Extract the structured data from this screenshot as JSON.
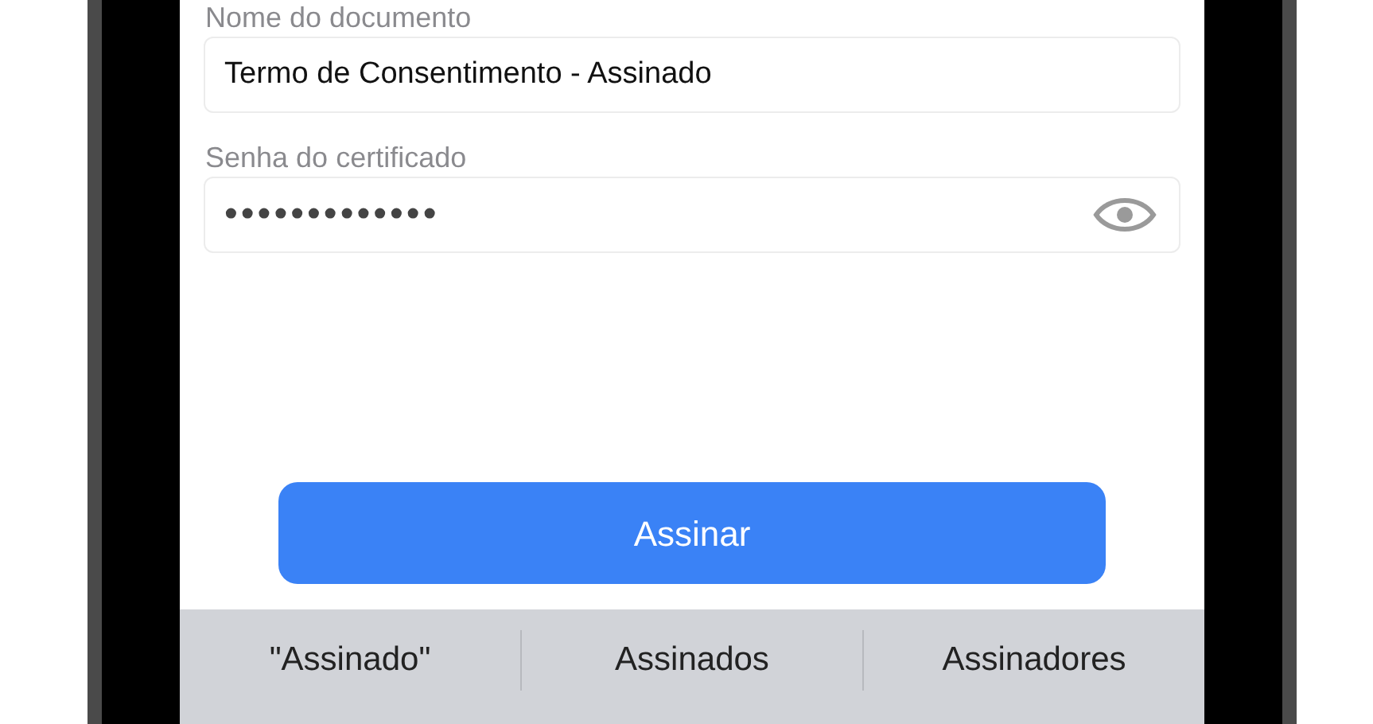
{
  "form": {
    "fields": [
      {
        "kind": "text",
        "label": "Nome do documento",
        "value": "Termo de Consentimento - Assinado"
      },
      {
        "kind": "password",
        "label": "Senha do certificado",
        "value": "•••••••••••••"
      }
    ],
    "submit_button": "Assinar"
  },
  "keyboard_suggestions": [
    "\"Assinado\"",
    "Assinados",
    "Assinadores"
  ]
}
